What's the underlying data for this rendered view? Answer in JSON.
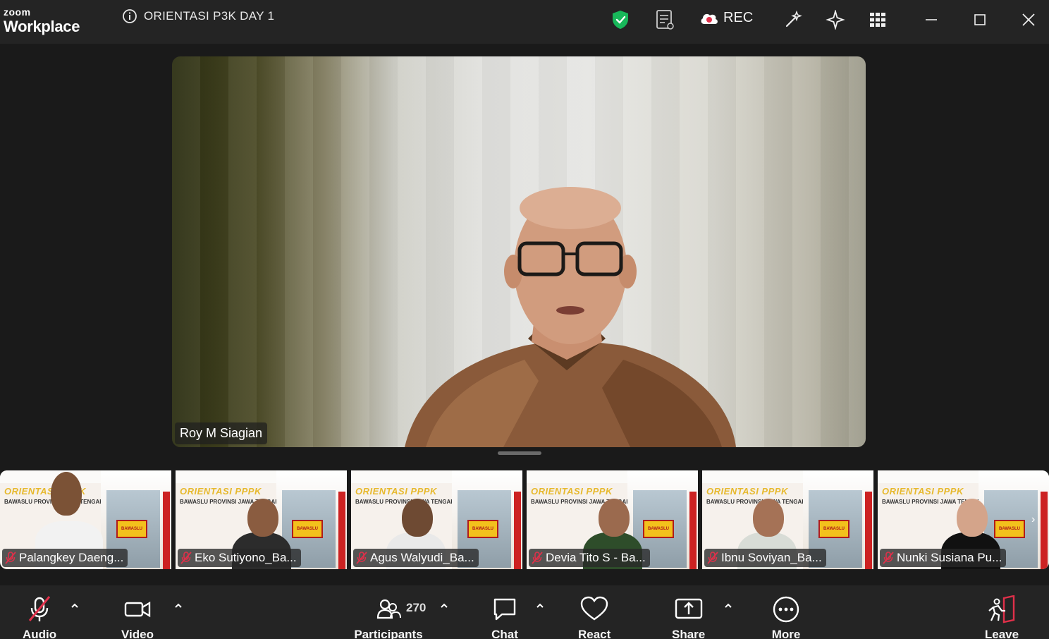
{
  "app": {
    "brand_top": "zoom",
    "brand_bottom": "Workplace"
  },
  "meeting": {
    "title": "ORIENTASI P3K DAY 1"
  },
  "titlebar": {
    "rec_label": "REC"
  },
  "main_speaker": {
    "name": "Roy M Siagian"
  },
  "thumbnails": [
    {
      "name": "Palangkey Daeng...",
      "muted": true
    },
    {
      "name": "Eko Sutiyono_Ba...",
      "muted": true
    },
    {
      "name": "Agus Walyudi_Ba...",
      "muted": true
    },
    {
      "name": "Devia Tito S - Ba...",
      "muted": true
    },
    {
      "name": "Ibnu Soviyan_Ba...",
      "muted": true
    },
    {
      "name": "Nunki Susiana Pu...",
      "muted": true
    }
  ],
  "background_text": {
    "orient": "ORIENTASI PPPK",
    "province": "BAWASLU PROVINSI JAWA TENGAH",
    "logo": "BAWASLU"
  },
  "toolbar": {
    "audio": "Audio",
    "video": "Video",
    "participants": "Participants",
    "participant_count": "270",
    "chat": "Chat",
    "react": "React",
    "share": "Share",
    "more": "More",
    "leave": "Leave"
  },
  "colors": {
    "titlebar_bg": "#242424",
    "stage_bg": "#1a1a1a",
    "shield": "#18b85a",
    "mute_red": "#e0304a",
    "leave_red": "#e0304a"
  }
}
